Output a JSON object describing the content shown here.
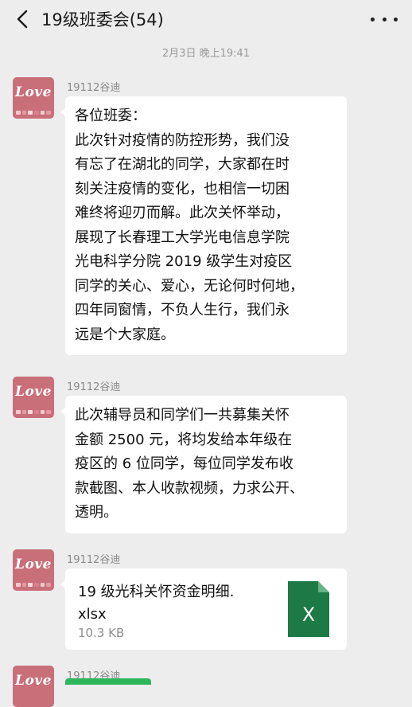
{
  "header": {
    "title": "19级班委会(54)",
    "back_icon": "chevron-left-icon",
    "more_icon": "more-dots-icon"
  },
  "timestamp": "2月3日 晚上19:41",
  "avatar_text": "Love",
  "messages": [
    {
      "sender": "19112谷迪",
      "lines": [
        "各位班委：",
        "此次针对疫情的防控形势，我们没",
        "有忘了在湖北的同学，大家都在时",
        "刻关注疫情的变化，也相信一切困",
        "难终将迎刃而解。此次关怀举动，",
        "展现了长春理工大学光电信息学院",
        "光电科学分院 2019 级学生对疫区",
        "同学的关心、爱心，无论何时何地，",
        "四年同窗情，不负人生行，我们永",
        "远是个大家庭。"
      ]
    },
    {
      "sender": "19112谷迪",
      "lines": [
        "此次辅导员和同学们一共募集关怀",
        "金额 2500 元，将均发给本年级在",
        "疫区的 6 位同学，每位同学发布收",
        "款截图、本人收款视频，力求公开、",
        "透明。"
      ]
    },
    {
      "sender": "19112谷迪",
      "file": {
        "name_line1": "19 级光科关怀资金明细.",
        "name_line2": "xlsx",
        "size": "10.3 KB",
        "icon_letter": "X",
        "icon": "excel-file-icon"
      }
    },
    {
      "sender": "19112谷迪"
    }
  ],
  "colors": {
    "background": "#ededed",
    "bubble": "#ffffff",
    "excel_green": "#1d7a45",
    "avatar_pink": "#c96f7a"
  }
}
